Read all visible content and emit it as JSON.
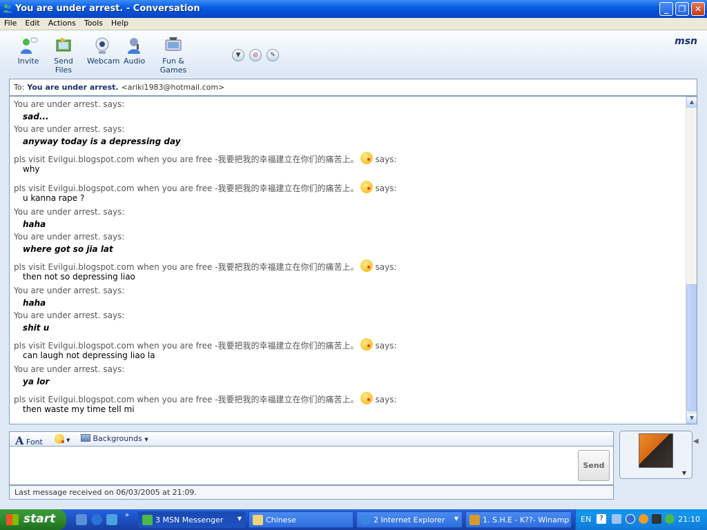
{
  "window": {
    "title": "You are under arrest. - Conversation",
    "controls": {
      "minimize": "_",
      "maximize": "❐",
      "close": "✕"
    }
  },
  "menu": [
    "File",
    "Edit",
    "Actions",
    "Tools",
    "Help"
  ],
  "toolbar": {
    "items": [
      {
        "label": "Invite",
        "icon": "invite-icon"
      },
      {
        "label": "Send Files",
        "icon": "send-files-icon"
      },
      {
        "label": "Webcam",
        "icon": "webcam-icon"
      },
      {
        "label": "Audio",
        "icon": "audio-icon"
      },
      {
        "label": "Fun & Games",
        "icon": "fun-games-icon"
      }
    ],
    "brand": "msn"
  },
  "recipient": {
    "label": "To:",
    "name": "You are under arrest.",
    "email": "<ariki1983@hotmail.com>"
  },
  "conversation": [
    {
      "sender": "You are under arrest. says:",
      "text": "sad...",
      "style": "bold-italic",
      "smiley": false
    },
    {
      "sender": "You are under arrest. says:",
      "text": "anyway today is a depressing day",
      "style": "bold-italic",
      "smiley": false
    },
    {
      "sender": "pls visit Evilgui.blogspot.com when you are free -我要把我的幸福建立在你们的痛苦上。",
      "says": "says:",
      "text": "why",
      "style": "plain",
      "smiley": true
    },
    {
      "sender": "pls visit Evilgui.blogspot.com when you are free -我要把我的幸福建立在你们的痛苦上。",
      "says": "says:",
      "text": "u kanna rape ?",
      "style": "plain",
      "smiley": true
    },
    {
      "sender": "You are under arrest. says:",
      "text": "haha",
      "style": "bold-italic",
      "smiley": false
    },
    {
      "sender": "You are under arrest. says:",
      "text": "where got so jia lat",
      "style": "bold-italic",
      "smiley": false
    },
    {
      "sender": "pls visit Evilgui.blogspot.com when you are free -我要把我的幸福建立在你们的痛苦上。",
      "says": "says:",
      "text": "then not so depressing liao",
      "style": "plain",
      "smiley": true
    },
    {
      "sender": "You are under arrest. says:",
      "text": "haha",
      "style": "bold-italic",
      "smiley": false
    },
    {
      "sender": "You are under arrest. says:",
      "text": "shit u",
      "style": "bold-italic",
      "smiley": false
    },
    {
      "sender": "pls visit Evilgui.blogspot.com when you are free -我要把我的幸福建立在你们的痛苦上。",
      "says": "says:",
      "text": "can laugh not depressing liao la",
      "style": "plain",
      "smiley": true
    },
    {
      "sender": "You are under arrest. says:",
      "text": "ya lor",
      "style": "bold-italic",
      "smiley": false
    },
    {
      "sender": "pls visit Evilgui.blogspot.com when you are free -我要把我的幸福建立在你们的痛苦上。",
      "says": "says:",
      "text": "then waste my time tell mi",
      "style": "plain",
      "smiley": true
    }
  ],
  "format_bar": {
    "font": "Font",
    "backgrounds": "Backgrounds"
  },
  "send_button": "Send",
  "status": "Last message received on 06/03/2005 at 21:09.",
  "taskbar": {
    "start": "start",
    "tasks": [
      {
        "label": "3 MSN Messenger",
        "active": true,
        "icon": "msn-icon"
      },
      {
        "label": "Chinese",
        "active": false,
        "icon": "folder-icon"
      },
      {
        "label": "2 Internet Explorer",
        "active": false,
        "icon": "ie-icon"
      },
      {
        "label": "1. S.H.E - K??- Winamp",
        "active": false,
        "icon": "winamp-icon"
      }
    ],
    "tray": {
      "language": "EN",
      "clock": "21:10"
    }
  }
}
